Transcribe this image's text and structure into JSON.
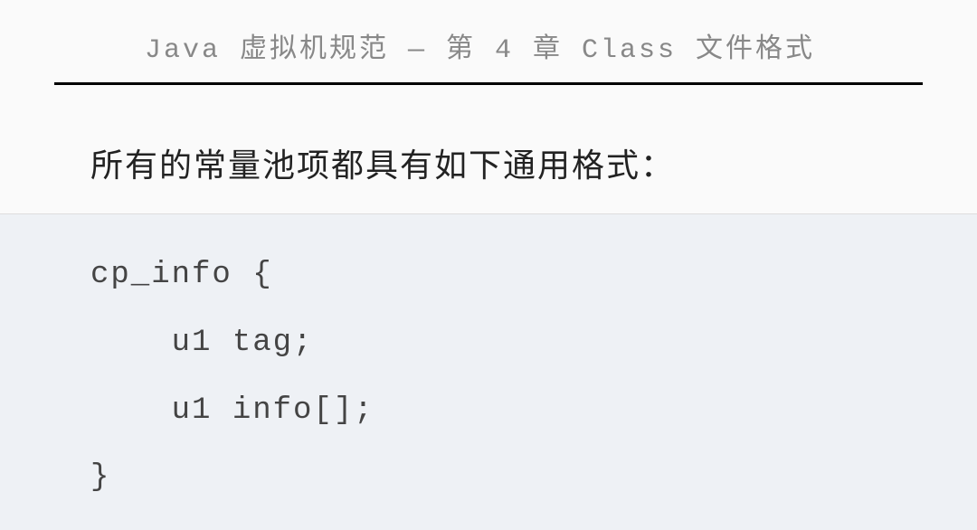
{
  "header": {
    "breadcrumb": "Java 虚拟机规范 — 第 4 章 Class 文件格式"
  },
  "content": {
    "intro": "所有的常量池项都具有如下通用格式："
  },
  "code": {
    "line1": "cp_info {",
    "line2": "    u1 tag;",
    "line3": "    u1 info[];",
    "line4": "}"
  }
}
